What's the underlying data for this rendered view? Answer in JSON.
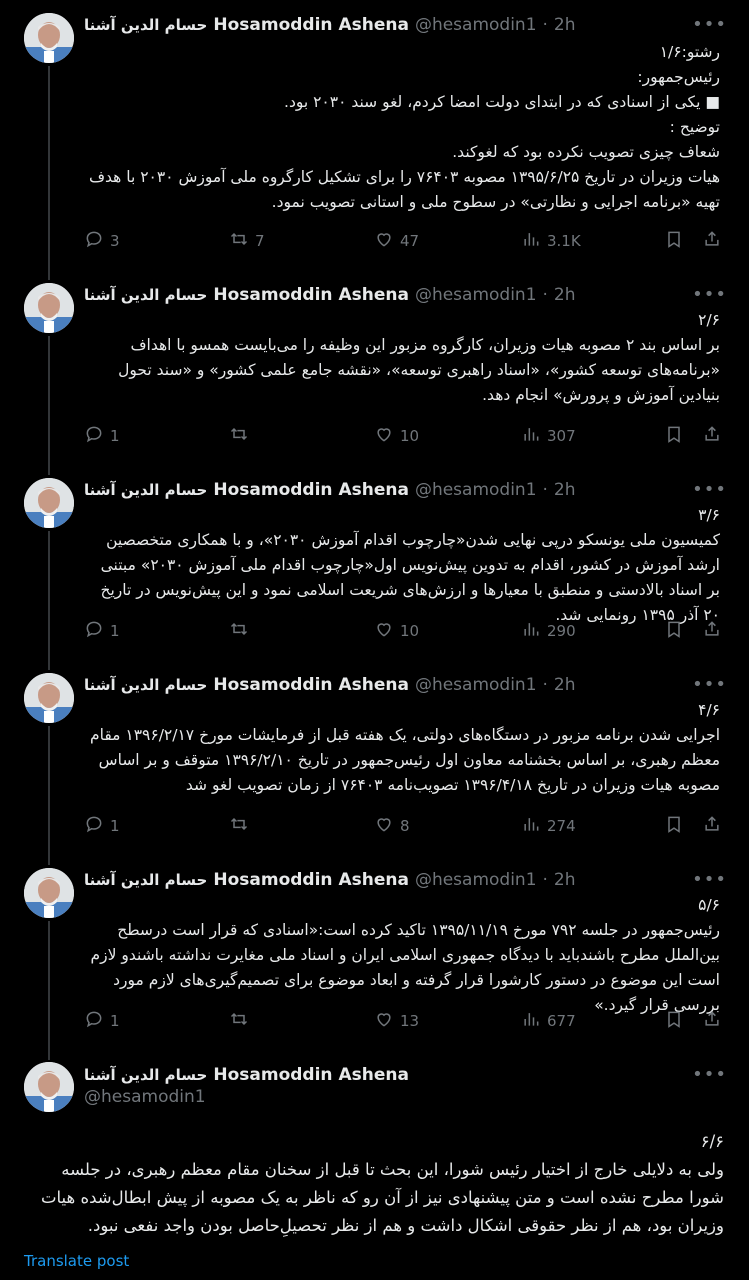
{
  "author": {
    "name_fa": "حسام الدین آشنا",
    "name_en": "Hosamoddin Ashena",
    "handle": "@hesamodin1",
    "time": "2h",
    "separator": "·"
  },
  "tweets": [
    {
      "text": "رشتو:۱/۶\nرئیس‌جمهور:\n■ یکی از اسنادی که در ابتدای دولت امضا کردم، لغو سند ۲۰۳۰ بود.\nتوضیح :\nشعاف چیزی تصویب نکرده بود که لغوکند.\nهیات وزیران در تاریخ ۱۳۹۵/۶/۲۵ مصوبه ۷۶۴۰۳ را برای تشکیل کارگروه ملی آموزش ۲۰۳۰ با هدف تهیه «برنامه اجرایی و نظارتی» در سطوح ملی و استانی تصویب نمود.",
      "replies": "3",
      "reposts": "7",
      "likes": "47",
      "views": "3.1K"
    },
    {
      "text": "۲/۶\nبر اساس بند ۲ مصوبه هیات وزیران، کارگروه مزبور این وظیفه را می‌بایست همسو با اهداف «برنامه‌های توسعه کشور»، «اسناد راهبری توسعه»، «نقشه جامع علمی کشور» و «سند تحول بنیادین آموزش و پرورش» انجام دهد.",
      "replies": "1",
      "reposts": "",
      "likes": "10",
      "views": "307"
    },
    {
      "text": "۳/۶\nکمیسیون ملی یونسکو درپی نهایی شدن«چارچوب اقدام آموزش ۲۰۳۰»، و با همکاری متخصصین ارشد آموزش در کشور، اقدام به تدوین پیش‌نویس اول«چارچوب اقدام ملی آموزش ۲۰۳۰» مبتنی بر اسناد بالادستی و منطبق با معیارها و ارزش‌های شریعت اسلامی نمود و این پیش‌نویس در تاریخ ۲۰ آذر ۱۳۹۵ رونمایی شد.",
      "replies": "1",
      "reposts": "",
      "likes": "10",
      "views": "290"
    },
    {
      "text": "۴/۶\nاجرایی شدن برنامه مزبور در دستگاه‌های دولتی، یک هفته قبل از فرمایشات مورخ ۱۳۹۶/۲/۱۷ مقام معظم رهبری، بر اساس بخشنامه معاون اول رئیس‌جمهور در تاریخ ۱۳۹۶/۲/۱۰ متوقف و بر اساس مصوبه هیات وزیران در تاریخ ۱۳۹۶/۴/۱۸ تصویب‌نامه ۷۶۴۰۳ از زمان تصویب لغو شد",
      "replies": "1",
      "reposts": "",
      "likes": "8",
      "views": "274"
    },
    {
      "text": "۵/۶\nرئیس‌جمهور در جلسه ۷۹۲ مورخ ۱۳۹۵/۱۱/۱۹ تاکید کرده است:«اسنادی که قرار است درسطح بین‌الملل مطرح باشندباید با دیدگاه جمهوری اسلامی ایران و اسناد ملی مغایرت نداشته باشندو لازم است این موضوع در دستور کارشورا قرار گرفته و ابعاد موضوع برای تصمیم‌گیری‌های لازم مورد بررسی قرار گیرد.»",
      "replies": "1",
      "reposts": "",
      "likes": "13",
      "views": "677"
    }
  ],
  "last_tweet": {
    "text": "۶/۶\nولی به دلایلی خارج از اختیار رئیس شورا، این بحث تا قبل از  سخنان مقام معظم رهبری، در جلسه  شورا مطرح نشده است و متن پیشنهادی نیز از آن رو که ناظر به یک مصوبه از پیش ابطال‌شده هیات وزیران بود، هم از نظر حقوقی اشکال داشت و هم از نظر تحصیلِ‌حاصل بودن واجد نفعی نبود.",
    "translate_label": "Translate post"
  },
  "icons": [
    "reply-icon",
    "repost-icon",
    "like-icon",
    "views-icon",
    "bookmark-icon",
    "share-icon",
    "more-icon"
  ],
  "colors": {
    "background": "#000000",
    "text": "#e7e9ea",
    "muted": "#71767b",
    "link": "#1d9bf0"
  }
}
